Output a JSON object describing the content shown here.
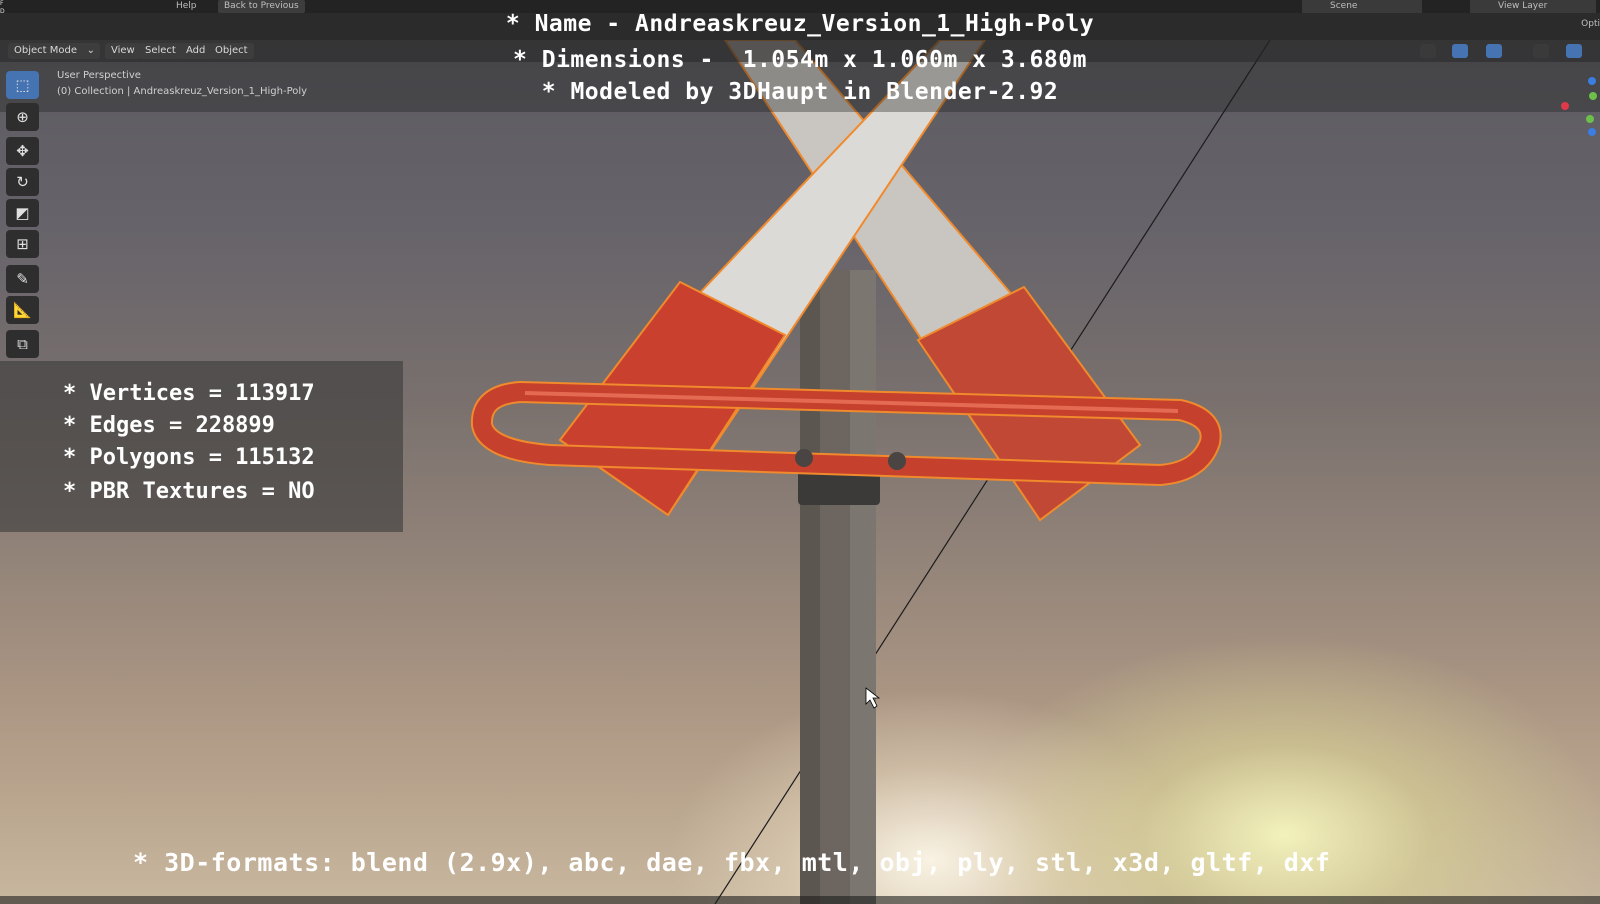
{
  "top_menu": {
    "help": "Help",
    "back": "Back to Previous",
    "scene": "Scene",
    "view_layer": "View Layer",
    "options": "Opti"
  },
  "viewport_header": {
    "mode": "Object Mode",
    "view": "View",
    "select": "Select",
    "add": "Add",
    "object": "Object"
  },
  "viewport_info": {
    "perspective": "User Perspective",
    "collection": "(0) Collection | Andreaskreuz_Version_1_High-Poly"
  },
  "overlay": {
    "name_line": "* Name - Andreaskreuz_Version_1_High-Poly",
    "dimensions_line": "* Dimensions -  1.054m x 1.060m x 3.680m",
    "modeled_line": "* Modeled by 3DHaupt in Blender-2.92"
  },
  "stats": {
    "vertices": "* Vertices = 113917",
    "edges": "* Edges = 228899",
    "polygons": "* Polygons = 115132",
    "pbr": "* PBR Textures = NO"
  },
  "formats": "* 3D-formats: blend (2.9x), abc, dae, fbx, mtl, obj, ply, stl, x3d, gltf, dxf",
  "colors": {
    "accent": "#4673b2",
    "selection_outline": "#f08a2c",
    "red": "#c8412e"
  },
  "tools": [
    "select-box-icon",
    "cursor-icon",
    "move-icon",
    "rotate-icon",
    "scale-icon",
    "transform-icon",
    "annotate-icon",
    "measure-icon",
    "add-cube-icon"
  ]
}
